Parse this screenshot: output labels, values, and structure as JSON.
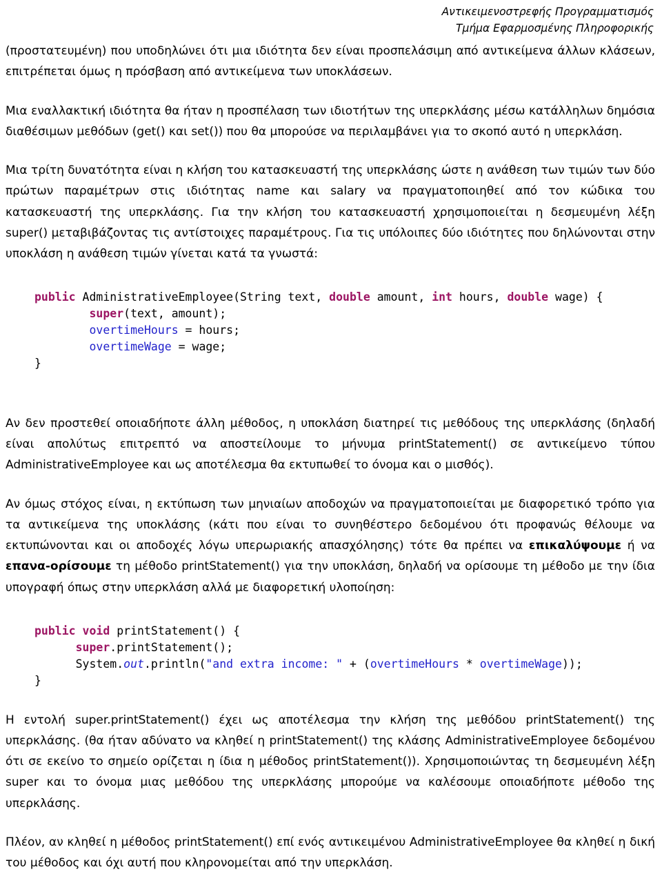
{
  "header": {
    "line1": "Αντικειμενοστρεφής Προγραμματισμός",
    "line2": "Τμήμα Εφαρμοσμένης Πληροφορικής"
  },
  "colors": {
    "text": "#000000",
    "background": "#ffffff",
    "code_keyword": "#9c1563",
    "code_field": "#2222cc",
    "code_string": "#2222cc"
  },
  "paragraphs": {
    "p1": "(προστατευμένη) που υποδηλώνει ότι μια ιδιότητα δεν είναι προσπελάσιμη από αντικείμενα άλλων κλάσεων, επιτρέπεται όμως η πρόσβαση από αντικείμενα των υποκλάσεων.",
    "p2": "Μια εναλλακτική ιδιότητα θα ήταν η προσπέλαση των ιδιοτήτων της υπερκλάσης μέσω κατάλληλων δημόσια διαθέσιμων μεθόδων (get() και set()) που θα μπορούσε να περιλαμβάνει για το σκοπό αυτό η υπερκλάση.",
    "p3": "Μια τρίτη δυνατότητα είναι η κλήση του κατασκευαστή της υπερκλάσης ώστε η ανάθεση των τιμών των δύο πρώτων παραμέτρων στις ιδιότητας name και salary να πραγματοποιηθεί από τον κώδικα του κατασκευαστή της υπερκλάσης. Για την κλήση του κατασκευαστή χρησιμοποιείται η δεσμευμένη λέξη super() μεταβιβάζοντας τις αντίστοιχες παραμέτρους. Για τις υπόλοιπες δύο ιδιότητες που δηλώνονται στην υποκλάση η ανάθεση τιμών γίνεται κατά τα γνωστά:",
    "p4": "Αν δεν προστεθεί οποιαδήποτε άλλη μέθοδος, η υποκλάση διατηρεί τις μεθόδους της υπερκλάσης (δηλαδή είναι απολύτως επιτρεπτό να αποστείλουμε το μήνυμα printStatement() σε αντικείμενο τύπου AdministrativeEmployee και ως αποτέλεσμα θα εκτυπωθεί το όνομα και ο μισθός).",
    "p5_a": "Αν όμως στόχος είναι, η εκτύπωση των μηνιαίων αποδοχών να πραγματοποιείται με διαφορετικό τρόπο για τα αντικείμενα της υποκλάσης (κάτι που είναι το συνηθέστερο δεδομένου ότι προφανώς θέλουμε να εκτυπώνονται και οι αποδοχές λόγω υπερωριακής απασχόλησης) τότε θα πρέπει να ",
    "p5_bold1": "επικαλύψουμε",
    "p5_b": " ή να ",
    "p5_bold2": "επανα-ορίσουμε",
    "p5_c": " τη μέθοδο printStatement() για την υποκλάση, δηλαδή να ορίσουμε τη μέθοδο με την ίδια υπογραφή όπως στην υπερκλάση αλλά με διαφορετική υλοποίηση:",
    "p6": "Η εντολή super.printStatement() έχει ως αποτέλεσμα την κλήση της μεθόδου printStatement() της υπερκλάσης. (θα ήταν αδύνατο να κληθεί η printStatement() της κλάσης AdministrativeEmployee δεδομένου ότι σε εκείνο το σημείο ορίζεται η ίδια η μέθοδος printStatement()). Χρησιμοποιώντας τη δεσμευμένη λέξη super και το όνομα μιας μεθόδου της υπερκλάσης μπορούμε να καλέσουμε οποιαδήποτε μέθοδο της υπερκλάσης.",
    "p7": "Πλέον, αν κληθεί η μέθοδος printStatement() επί ενός αντικειμένου AdministrativeEmployee θα κληθεί η δική του μέθοδος και όχι αυτή που κληρονομείται από την υπερκλάση."
  },
  "code_block_1": {
    "line1_kw": "public",
    "line1_rest": " AdministrativeEmployee(String text, ",
    "line1_kw2": "double",
    "line1_rest2": " amount, ",
    "line1_kw3": "int",
    "line1_rest3": " hours, ",
    "line1_kw4": "double",
    "line1_rest4": " wage) {",
    "line2_kw": "super",
    "line2_rest": "(text, amount);",
    "line3_fld": "overtimeHours",
    "line3_rest": " = hours;",
    "line4_fld": "overtimeWage",
    "line4_rest": " = wage;",
    "line5": "}"
  },
  "code_block_2": {
    "line1_kw": "public void",
    "line1_rest": " printStatement() {",
    "line2_kw": "super",
    "line2_rest": ".printStatement();",
    "line3_a": "System.",
    "line3_static": "out",
    "line3_b": ".println(",
    "line3_str": "\"and extra income: \"",
    "line3_c": " + (",
    "line3_fld1": "overtimeHours",
    "line3_d": " * ",
    "line3_fld2": "overtimeWage",
    "line3_e": "));",
    "line4": "}"
  }
}
